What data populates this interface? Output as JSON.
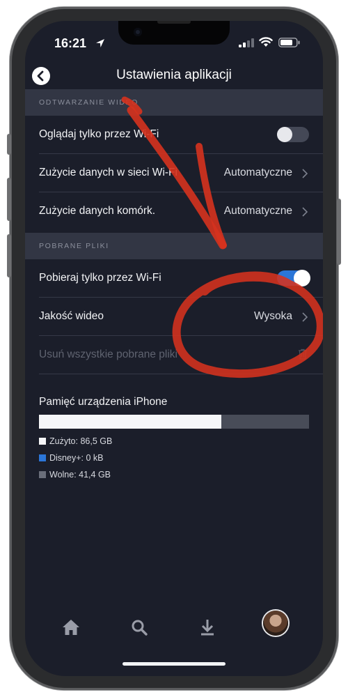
{
  "status_bar": {
    "time": "16:21"
  },
  "header": {
    "title": "Ustawienia aplikacji"
  },
  "sections": {
    "video": {
      "title": "ODTWARZANIE WIDEO",
      "wifi_only_label": "Oglądaj tylko przez Wi-Fi",
      "wifi_only_state": "off",
      "wifi_data_label": "Zużycie danych w sieci Wi-Fi",
      "wifi_data_value": "Automatyczne",
      "cell_data_label": "Zużycie danych komórk.",
      "cell_data_value": "Automatyczne"
    },
    "downloads": {
      "title": "POBRANE PLIKI",
      "download_wifi_label": "Pobieraj tylko przez Wi-Fi",
      "download_wifi_state": "on",
      "quality_label": "Jakość wideo",
      "quality_value": "Wysoka",
      "delete_label": "Usuń wszystkie pobrane pliki"
    }
  },
  "storage": {
    "title": "Pamięć urządzenia iPhone",
    "used_fraction": 0.676,
    "legend": {
      "used": "Zużyto: 86,5 GB",
      "disney": "Disney+: 0 kB",
      "free": "Wolne: 41,4 GB"
    },
    "colors": {
      "used": "#f5f6f8",
      "disney": "#2b76d8",
      "free": "#484c58"
    }
  },
  "tabbar": {
    "items": [
      "home-icon",
      "search-icon",
      "download-icon",
      "profile-avatar"
    ]
  },
  "colors": {
    "background": "#1b1e2a",
    "section": "#323644",
    "accent": "#2b76d8",
    "annotation": "#d6321e"
  }
}
